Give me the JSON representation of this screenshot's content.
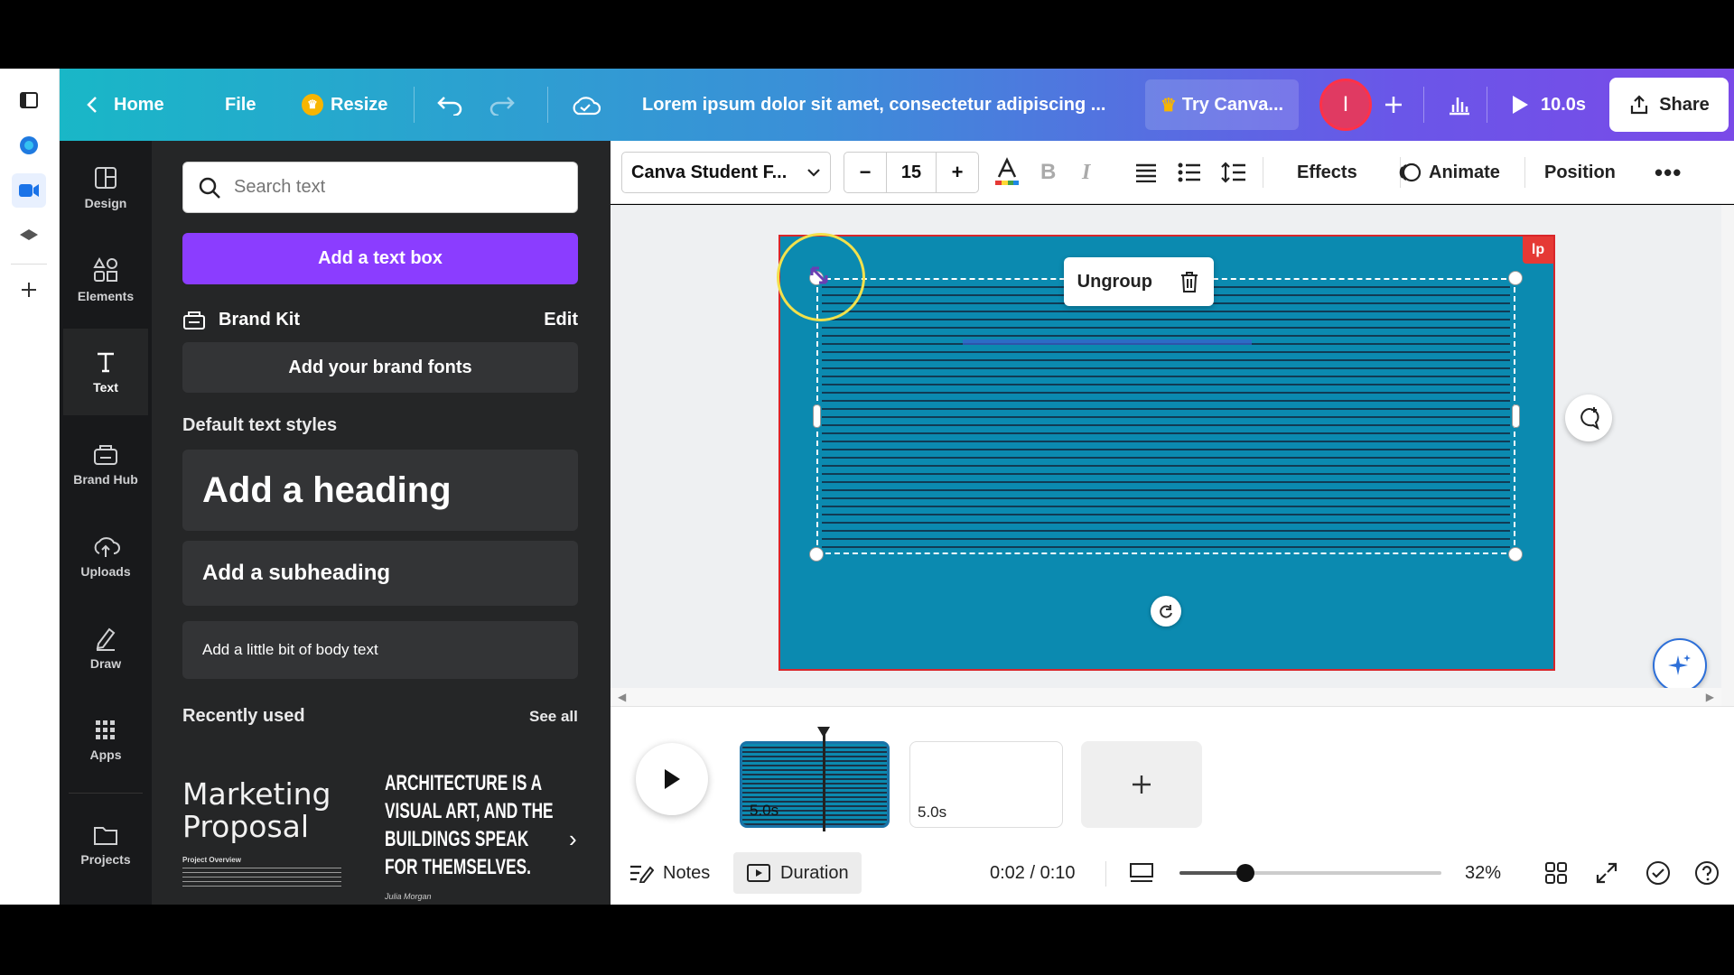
{
  "header": {
    "home": "Home",
    "file": "File",
    "resize": "Resize",
    "title": "Lorem ipsum dolor sit amet, consectetur adipiscing ...",
    "try_canva": "Try Canva...",
    "avatar_initial": "I",
    "duration": "10.0s",
    "share": "Share"
  },
  "sidebar": {
    "items": [
      {
        "label": "Design",
        "icon": "layout-icon"
      },
      {
        "label": "Elements",
        "icon": "shapes-icon"
      },
      {
        "label": "Text",
        "icon": "text-icon"
      },
      {
        "label": "Brand Hub",
        "icon": "brand-icon"
      },
      {
        "label": "Uploads",
        "icon": "upload-icon"
      },
      {
        "label": "Draw",
        "icon": "pen-icon"
      },
      {
        "label": "Apps",
        "icon": "grid-icon"
      },
      {
        "label": "Projects",
        "icon": "folder-icon"
      }
    ],
    "active": "Text"
  },
  "panel": {
    "search_placeholder": "Search text",
    "add_text_box": "Add a text box",
    "brand_kit": "Brand Kit",
    "edit": "Edit",
    "add_brand_fonts": "Add your brand fonts",
    "default_styles": "Default text styles",
    "heading": "Add a heading",
    "subheading": "Add a subheading",
    "body": "Add a little bit of body text",
    "recently_used": "Recently used",
    "see_all": "See all",
    "thumb1_title": "Marketing Proposal",
    "thumb1_sub": "Project Overview",
    "thumb2_title": "ARCHITECTURE IS A VISUAL ART, AND THE BUILDINGS SPEAK FOR THEMSELVES.",
    "thumb2_author": "Julia Morgan"
  },
  "toolbar": {
    "font": "Canva Student F...",
    "size": "15",
    "effects": "Effects",
    "animate": "Animate",
    "position": "Position"
  },
  "canvas": {
    "ungroup": "Ungroup",
    "badge": "lp",
    "page_color": "#0b8ab0"
  },
  "timeline": {
    "clip1_duration": "5.0s",
    "clip2_duration": "5.0s"
  },
  "footer": {
    "notes": "Notes",
    "duration": "Duration",
    "time": "0:02 / 0:10",
    "zoom": "32%",
    "zoom_fraction": 0.25
  },
  "colors": {
    "accent_purple": "#8b3dff",
    "selection_red": "#d9262a"
  }
}
